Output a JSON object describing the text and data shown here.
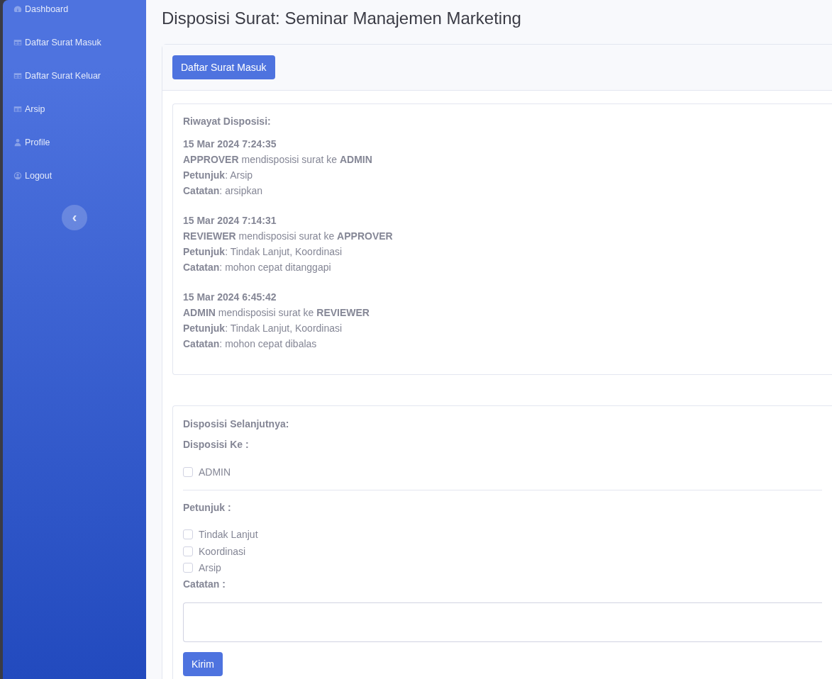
{
  "sidebar": {
    "items": [
      {
        "label": "Dashboard",
        "kind": "gauge"
      },
      {
        "label": "Daftar Surat Masuk",
        "kind": "table"
      },
      {
        "label": "Daftar Surat Keluar",
        "kind": "table"
      },
      {
        "label": "Arsip",
        "kind": "table"
      },
      {
        "label": "Profile",
        "kind": "user"
      },
      {
        "label": "Logout",
        "kind": "account"
      }
    ],
    "toggle": "‹"
  },
  "page_title": "Disposisi Surat: Seminar Manajemen Marketing",
  "header_button": "Daftar Surat Masuk",
  "history": {
    "title": "Riwayat Disposisi:",
    "entries": [
      {
        "time": "15 Mar 2024 7:24:35",
        "action": "**APPROVER** mendisposisi surat ke **ADMIN**",
        "petunjuk": "**Petunjuk**: Arsip",
        "catatan": "**Catatan**: arsipkan"
      },
      {
        "time": "15 Mar 2024 7:14:31",
        "action": "**REVIEWER** mendisposisi surat ke **APPROVER**",
        "petunjuk": "**Petunjuk**: Tindak Lanjut, Koordinasi",
        "catatan": "**Catatan**: mohon cepat ditanggapi"
      },
      {
        "time": "15 Mar 2024 6:45:42",
        "action": "**ADMIN** mendisposisi surat ke **REVIEWER**",
        "petunjuk": "**Petunjuk**: Tindak Lanjut, Koordinasi",
        "catatan": "**Catatan**: mohon cepat dibalas"
      }
    ]
  },
  "form": {
    "title": "Disposisi Selanjutnya:",
    "disposisi_label": "Disposisi Ke :",
    "disposisi_options": [
      {
        "label": "ADMIN",
        "checked": false
      }
    ],
    "petunjuk_label": "Petunjuk :",
    "petunjuk_options": [
      {
        "label": "Tindak Lanjut",
        "checked": false
      },
      {
        "label": "Koordinasi",
        "checked": false
      },
      {
        "label": "Arsip",
        "checked": false
      }
    ],
    "catatan_label": "Catatan :",
    "submit": "Kirim"
  }
}
